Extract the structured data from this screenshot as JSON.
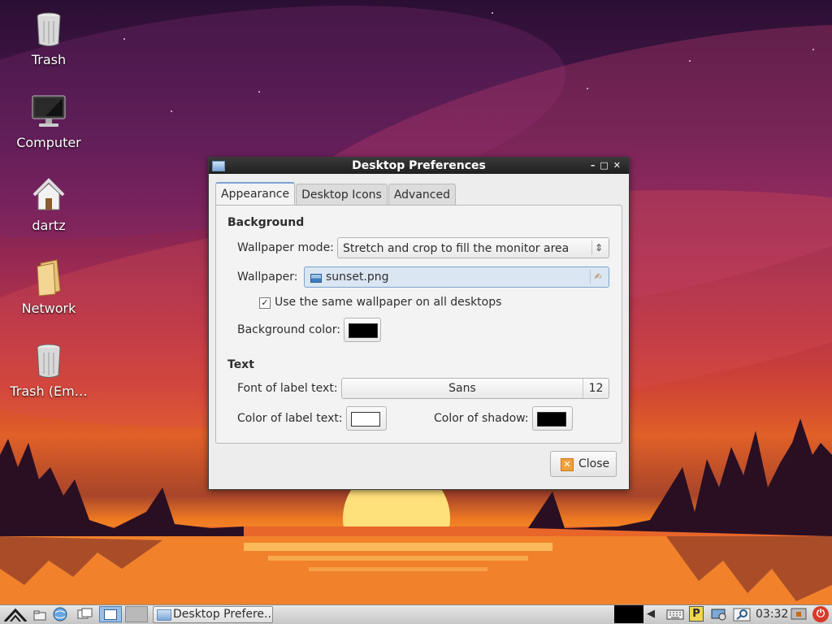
{
  "desktop": {
    "icons": [
      {
        "label": "Trash",
        "icon": "trash-icon"
      },
      {
        "label": "Computer",
        "icon": "computer-icon"
      },
      {
        "label": "dartz",
        "icon": "home-folder-icon"
      },
      {
        "label": "Network",
        "icon": "network-folder-icon"
      },
      {
        "label": "Trash (Em…",
        "icon": "trash-empty-icon"
      }
    ]
  },
  "dialog": {
    "title": "Desktop Preferences",
    "tabs": [
      {
        "label": "Appearance",
        "active": true
      },
      {
        "label": "Desktop Icons",
        "active": false
      },
      {
        "label": "Advanced",
        "active": false
      }
    ],
    "background": {
      "heading": "Background",
      "wallpaper_mode_label": "Wallpaper mode:",
      "wallpaper_mode_value": "Stretch and crop to fill the monitor area",
      "wallpaper_label": "Wallpaper:",
      "wallpaper_file": "sunset.png",
      "same_wallpaper_label": "Use the same wallpaper on all desktops",
      "same_wallpaper_checked": true,
      "background_color_label": "Background color:",
      "background_color": "#000000"
    },
    "text": {
      "heading": "Text",
      "font_label": "Font of label text:",
      "font_name": "Sans",
      "font_size": "12",
      "label_color_label": "Color of label text:",
      "label_color": "#ffffff",
      "shadow_color_label": "Color of shadow:",
      "shadow_color": "#000000"
    },
    "close_label": "Close"
  },
  "taskbar": {
    "window_button_label": "Desktop Prefere...",
    "clock": "03:32"
  },
  "colors": {
    "titlebar": "#2a2a2a",
    "accent": "#7ca3d1",
    "dialog_bg": "#ededed"
  }
}
